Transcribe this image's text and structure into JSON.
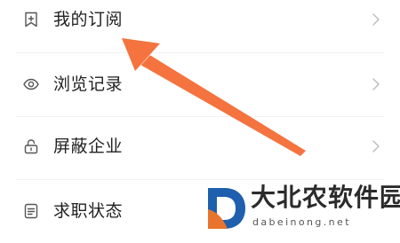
{
  "menu": {
    "items": [
      {
        "label": "我的订阅",
        "icon": "bookmark-plus-icon"
      },
      {
        "label": "浏览记录",
        "icon": "eye-icon"
      },
      {
        "label": "屏蔽企业",
        "icon": "lock-icon"
      },
      {
        "label": "求职状态",
        "icon": "document-list-icon"
      }
    ]
  },
  "annotation": {
    "arrow_color": "#f4733f"
  },
  "watermark": {
    "title": "大北农软件园",
    "domain": "dabeinong.net",
    "logo_letter": "D"
  }
}
